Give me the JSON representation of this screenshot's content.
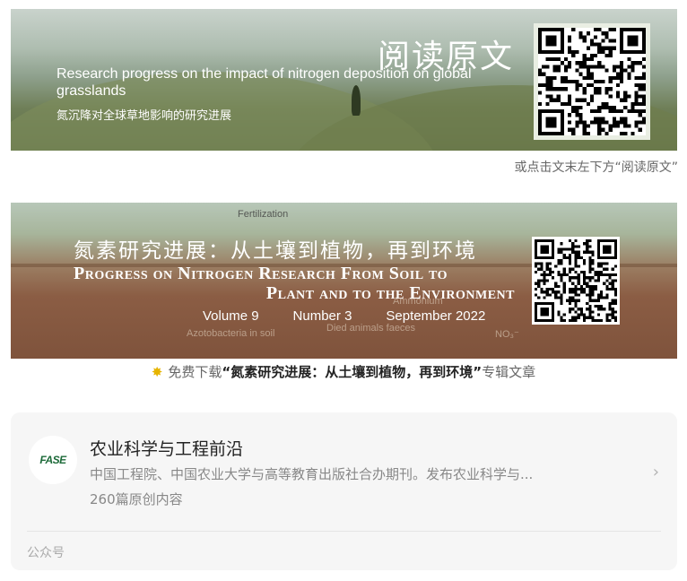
{
  "banner1": {
    "title": "阅读原文",
    "subtitle_en": "Research progress on the impact of nitrogen deposition on global grasslands",
    "subtitle_zh": "氮沉降对全球草地影响的研究进展"
  },
  "caption1": "或点击文末左下方“阅读原文”",
  "banner2": {
    "label_fertilization": "Fertilization",
    "title_zh": "氮素研究进展：从土壤到植物，再到环境",
    "title_en_line1": "Progress on Nitrogen Research From Soil to",
    "title_en_line2": "Plant and to the Environment",
    "volume": "Volume 9",
    "number": "Number 3",
    "date": "September 2022",
    "bg_labels": [
      "Azotobacteria in soil",
      "Died animals faeces",
      "Ammonium",
      "NO₃⁻"
    ]
  },
  "caption2": {
    "prefix": "免费下载",
    "highlight": "“氮素研究进展：从土壤到植物，再到环境”",
    "suffix": "专辑文章"
  },
  "account": {
    "logo_text": "FASE",
    "name": "农业科学与工程前沿",
    "description": "中国工程院、中国农业大学与高等教育出版社合办期刊。发布农业科学与...",
    "article_count": "260篇原创内容",
    "type_label": "公众号"
  },
  "colors": {
    "caption": "#666666",
    "card_bg": "#f6f6f6",
    "muted": "#888888"
  }
}
